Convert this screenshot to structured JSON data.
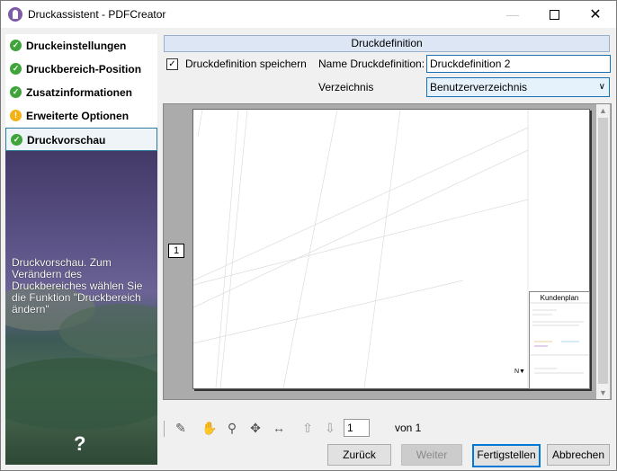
{
  "window": {
    "title": "Druckassistent - PDFCreator",
    "minimize_icon": "minimize-icon",
    "maximize_icon": "maximize-icon",
    "close_icon": "close-icon"
  },
  "sidebar": {
    "steps": [
      {
        "label": "Druckeinstellungen",
        "status": "ok"
      },
      {
        "label": "Druckbereich-Position",
        "status": "ok"
      },
      {
        "label": "Zusatzinformationen",
        "status": "ok"
      },
      {
        "label": "Erweiterte Optionen",
        "status": "warning"
      },
      {
        "label": "Druckvorschau",
        "status": "ok"
      }
    ],
    "help_text": "Druckvorschau. Zum Verändern des Druckbereiches wählen Sie die Funktion \"Druckbereich ändern\"",
    "help_icon": "?"
  },
  "main": {
    "section_title": "Druckdefinition",
    "save_checkbox": {
      "label": "Druckdefinition speichern",
      "checked": true
    },
    "name_label": "Name Druckdefinition:",
    "name_value": "Druckdefinition 2",
    "dir_label": "Verzeichnis",
    "dir_value": "Benutzerverzeichnis"
  },
  "preview": {
    "page_badge": "1",
    "title_block": "Kundenplan"
  },
  "toolbar": {
    "page_value": "1",
    "of_label": "von 1"
  },
  "buttons": {
    "back": "Zurück",
    "next": "Weiter",
    "finish": "Fertigstellen",
    "cancel": "Abbrechen"
  },
  "colors": {
    "accent": "#0078d7",
    "ok": "#3fa53a",
    "warning": "#f3b316",
    "sidebar_bg": "#3b3358"
  }
}
